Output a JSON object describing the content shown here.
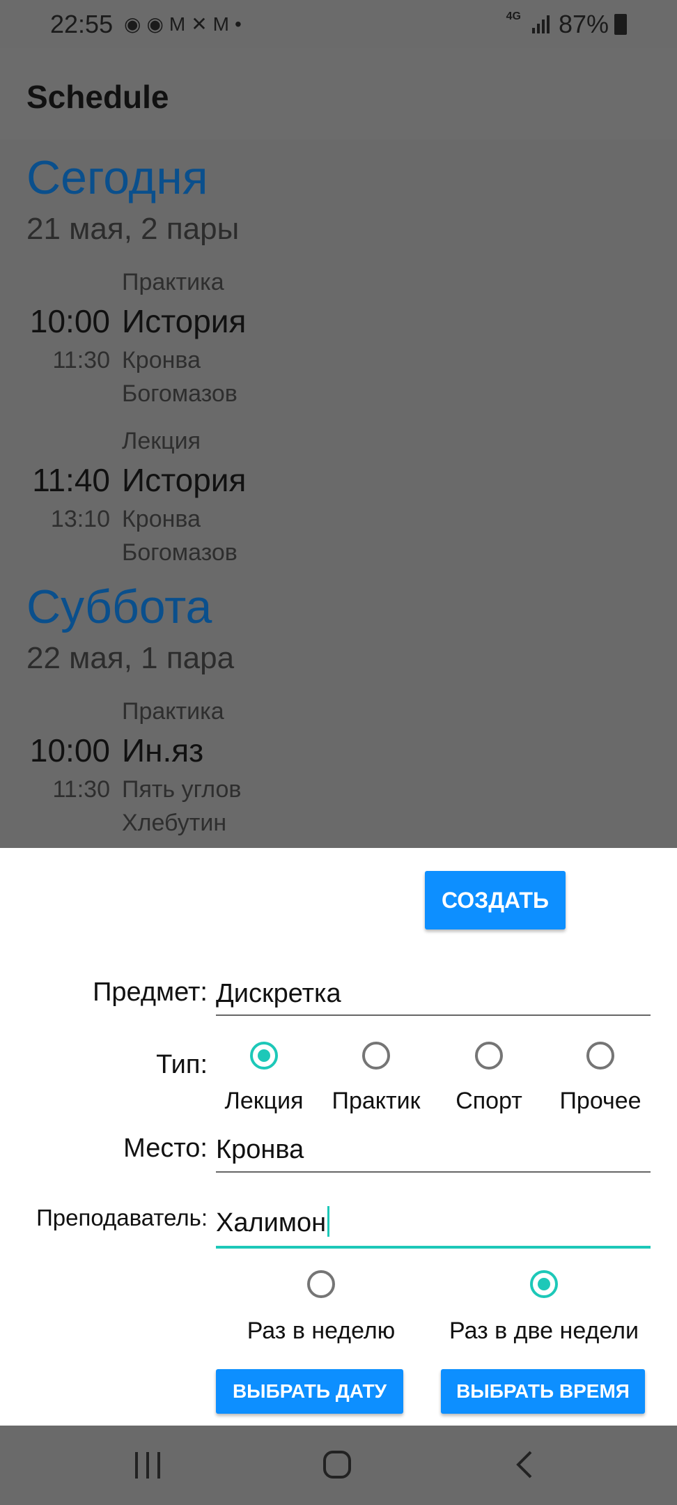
{
  "status_bar": {
    "time": "22:55",
    "notification_icons": [
      "rss-icon",
      "rss-icon",
      "gmail-icon",
      "app-icon",
      "gmail-icon",
      "dot-icon"
    ],
    "network": "4G",
    "battery": "87%"
  },
  "app_bar": {
    "title": "Schedule"
  },
  "schedule": {
    "days": [
      {
        "name": "Сегодня",
        "date": "21 мая, 2 пары",
        "lessons": [
          {
            "type": "Практика",
            "start": "10:00",
            "end": "11:30",
            "name": "История",
            "place": "Кронва",
            "teacher": "Богомазов"
          },
          {
            "type": "Лекция",
            "start": "11:40",
            "end": "13:10",
            "name": "История",
            "place": "Кронва",
            "teacher": "Богомазов"
          }
        ]
      },
      {
        "name": "Суббота",
        "date": "22 мая, 1 пара",
        "lessons": [
          {
            "type": "Практика",
            "start": "10:00",
            "end": "11:30",
            "name": "Ин.яз",
            "place": "Пять углов",
            "teacher": "Хлебутин"
          }
        ]
      }
    ]
  },
  "form": {
    "create_button": "СОЗДАТЬ",
    "subject_label": "Предмет:",
    "subject_value": "Дискретка",
    "type_label": "Тип:",
    "type_options": [
      "Лекция",
      "Практик",
      "Спорт",
      "Прочее"
    ],
    "type_selected": "Лекция",
    "place_label": "Место:",
    "place_value": "Кронва",
    "teacher_label": "Преподаватель:",
    "teacher_value": "Халимон",
    "frequency_options": [
      "Раз в неделю",
      "Раз в две недели"
    ],
    "frequency_selected": "Раз в две недели",
    "pick_date_button": "ВЫБРАТЬ ДАТУ",
    "pick_time_button": "ВЫБРАТЬ ВРЕМЯ"
  },
  "nav_bar": {
    "icons": [
      "recent-apps-icon",
      "home-icon",
      "back-icon"
    ]
  },
  "colors": {
    "accent": "#0d8fff",
    "radio_selected": "#1dc8b8",
    "day_header": "#0a4f8c",
    "scrim": "#6a6a6a"
  }
}
